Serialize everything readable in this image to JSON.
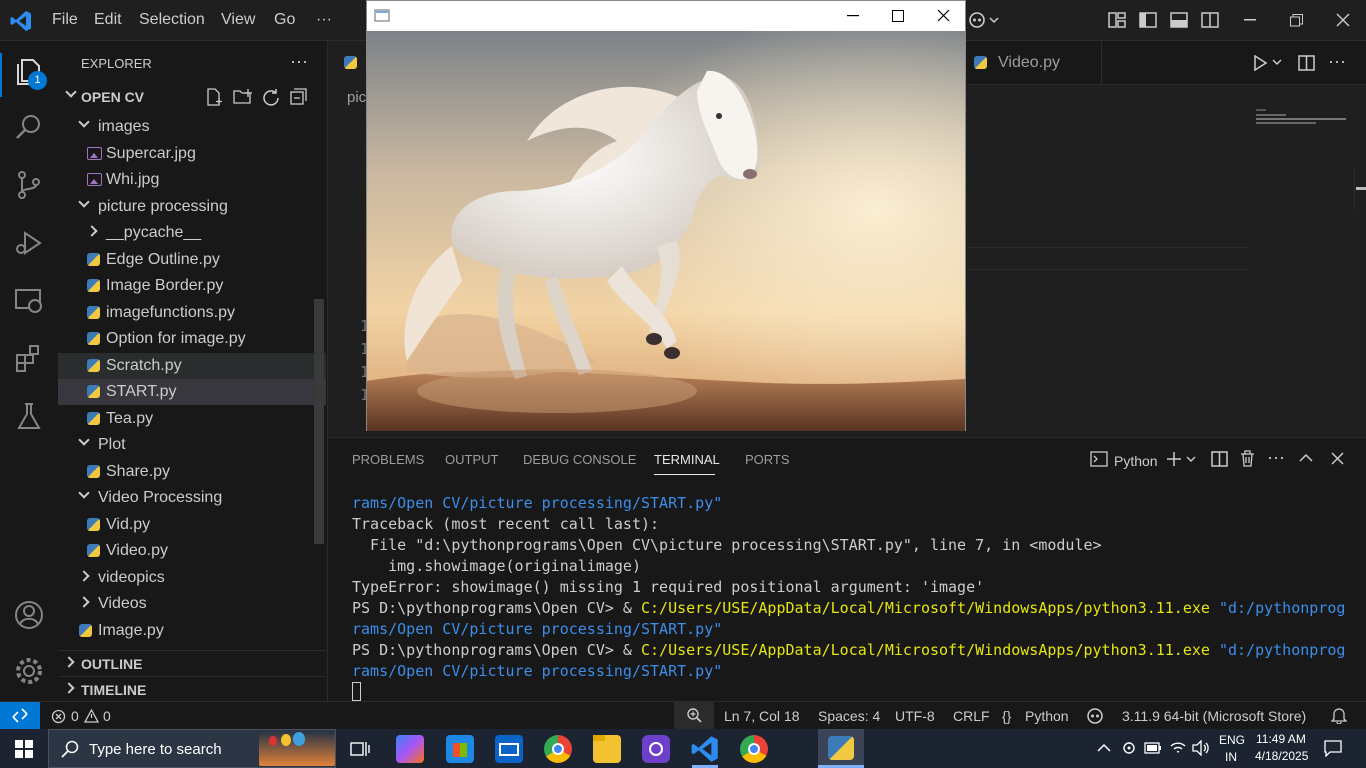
{
  "menu": [
    "File",
    "Edit",
    "Selection",
    "View",
    "Go",
    "···"
  ],
  "sidebar": {
    "title": "EXPLORER",
    "more": "···",
    "root": "OPEN CV",
    "items": [
      {
        "label": "images",
        "kind": "folder-open",
        "indent": 1
      },
      {
        "label": "Supercar.jpg",
        "kind": "image",
        "indent": 2
      },
      {
        "label": "Whi.jpg",
        "kind": "image",
        "indent": 2
      },
      {
        "label": "picture processing",
        "kind": "folder-open",
        "indent": 1
      },
      {
        "label": "__pycache__",
        "kind": "folder-closed",
        "indent": 2
      },
      {
        "label": "Edge Outline.py",
        "kind": "py",
        "indent": 2
      },
      {
        "label": "Image Border.py",
        "kind": "py",
        "indent": 2
      },
      {
        "label": "imagefunctions.py",
        "kind": "py",
        "indent": 2
      },
      {
        "label": "Option for image.py",
        "kind": "py",
        "indent": 2
      },
      {
        "label": "Scratch.py",
        "kind": "py",
        "indent": 2
      },
      {
        "label": "START.py",
        "kind": "py",
        "indent": 2
      },
      {
        "label": "Tea.py",
        "kind": "py",
        "indent": 2
      },
      {
        "label": "Plot",
        "kind": "folder-open",
        "indent": 1
      },
      {
        "label": "Share.py",
        "kind": "py",
        "indent": 2
      },
      {
        "label": "Video Processing",
        "kind": "folder-open",
        "indent": 1
      },
      {
        "label": "Vid.py",
        "kind": "py",
        "indent": 2
      },
      {
        "label": "Video.py",
        "kind": "py",
        "indent": 2
      },
      {
        "label": "videopics",
        "kind": "folder-closed",
        "indent": 1
      },
      {
        "label": "Videos",
        "kind": "folder-closed",
        "indent": 1
      },
      {
        "label": "Image.py",
        "kind": "py",
        "indent": 1
      }
    ],
    "outline": "OUTLINE",
    "timeline": "TIMELINE"
  },
  "activity": {
    "explorer_badge": "1"
  },
  "editor": {
    "tab_video": "Video.py",
    "breadcrumb": "pic",
    "line_numbers": [
      "1",
      "1",
      "1",
      "1"
    ]
  },
  "panel": {
    "tabs": [
      "PROBLEMS",
      "OUTPUT",
      "DEBUG CONSOLE",
      "TERMINAL",
      "PORTS"
    ],
    "active_tab": "TERMINAL",
    "shell": "Python",
    "lines": [
      [
        {
          "t": "rams/Open CV/picture processing/START.py\"",
          "c": "#3b8eea"
        }
      ],
      [
        {
          "t": "Traceback (most recent call last):",
          "c": "#cccccc"
        }
      ],
      [
        {
          "t": "  File \"d:\\pythonprograms\\Open CV\\picture processing\\START.py\", line 7, in <module>",
          "c": "#cccccc"
        }
      ],
      [
        {
          "t": "    img.showimage(originalimage)",
          "c": "#cccccc"
        }
      ],
      [
        {
          "t": "TypeError: showimage() missing 1 required positional argument: 'image'",
          "c": "#cccccc"
        }
      ],
      [
        {
          "t": "PS D:\\pythonprograms\\Open CV> & ",
          "c": "#cccccc"
        },
        {
          "t": "C:/Users/USE/AppData/Local/Microsoft/WindowsApps/python3.11.exe",
          "c": "#e5e510"
        },
        {
          "t": " \"d:/pythonprog",
          "c": "#3b8eea"
        }
      ],
      [
        {
          "t": "rams/Open CV/picture processing/START.py\"",
          "c": "#3b8eea"
        }
      ],
      [
        {
          "t": "PS D:\\pythonprograms\\Open CV> & ",
          "c": "#cccccc"
        },
        {
          "t": "C:/Users/USE/AppData/Local/Microsoft/WindowsApps/python3.11.exe",
          "c": "#e5e510"
        },
        {
          "t": " \"d:/pythonprog",
          "c": "#3b8eea"
        }
      ],
      [
        {
          "t": "rams/Open CV/picture processing/START.py\"",
          "c": "#3b8eea"
        }
      ]
    ]
  },
  "status": {
    "errors": "0",
    "warnings": "0",
    "cursor": "Ln 7, Col 18",
    "spaces": "Spaces: 4",
    "encoding": "UTF-8",
    "eol": "CRLF",
    "language": "Python",
    "interpreter": "3.11.9 64-bit (Microsoft Store)"
  },
  "taskbar": {
    "search_placeholder": "Type here to search",
    "lang_top": "ENG",
    "lang_bottom": "IN",
    "time": "11:49 AM",
    "date": "4/18/2025"
  },
  "colors": {
    "accent": "#0078d4",
    "python_blue": "#3d7ab8",
    "python_yellow": "#f0c940"
  }
}
